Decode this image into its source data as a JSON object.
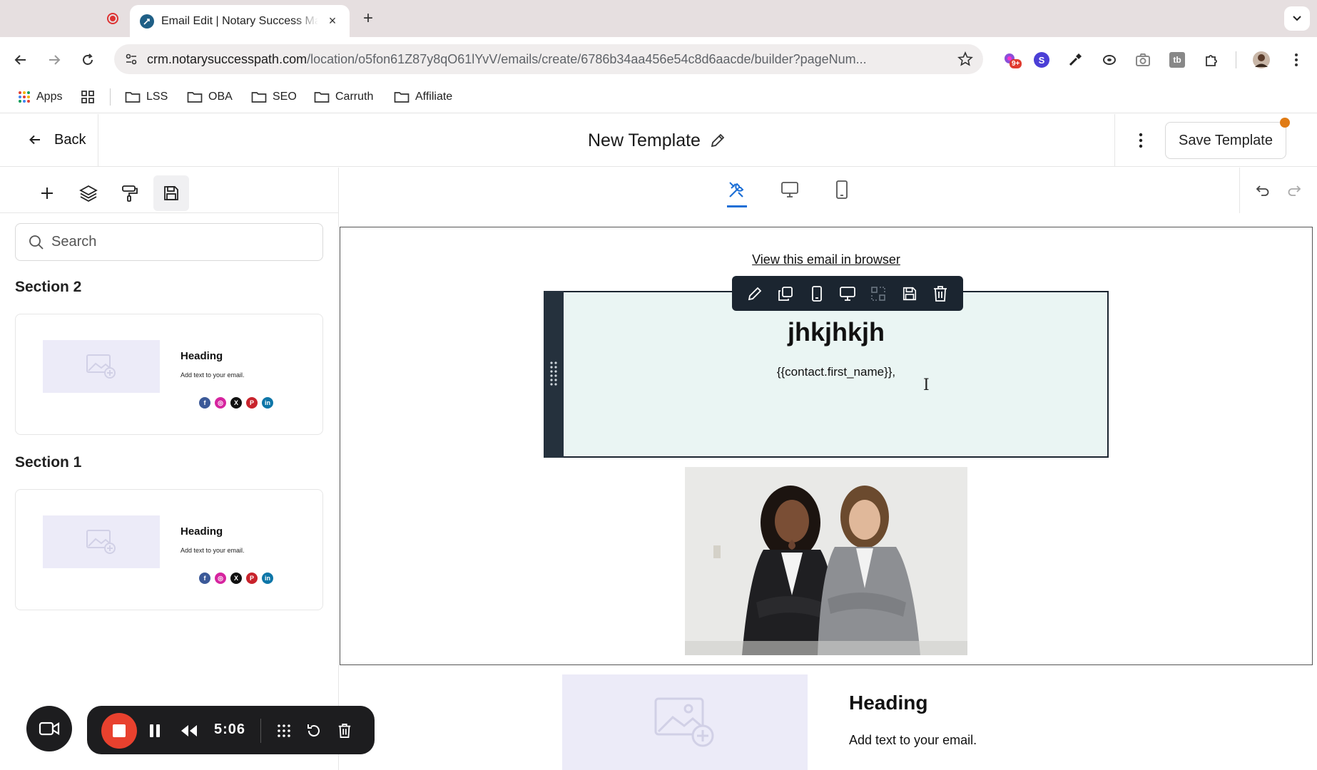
{
  "browser": {
    "tab_title": "Email Edit | Notary Success Mastery",
    "close_glyph": "×",
    "new_tab_glyph": "+",
    "url_host": "crm.notarysuccesspath.com",
    "url_path": "/location/o5fon61Z87y8qO61lYvV/emails/create/6786b34aa456e54c8d6aacde/builder?pageNum...",
    "extension_badge": "9+",
    "extension_s": "S",
    "extension_tb": "tb",
    "bookmarks": [
      {
        "label": "Apps"
      },
      {
        "label": "LSS"
      },
      {
        "label": "OBA"
      },
      {
        "label": "SEO"
      },
      {
        "label": "Carruth"
      },
      {
        "label": "Affiliate"
      }
    ]
  },
  "header": {
    "back_label": "Back",
    "title": "New Template",
    "save_label": "Save Template",
    "unsaved_dot_color": "#e07b14"
  },
  "left_panel": {
    "search_placeholder": "Search",
    "sections": [
      {
        "label": "Section 2",
        "heading": "Heading",
        "text": "Add text to your email."
      },
      {
        "label": "Section 1",
        "heading": "Heading",
        "text": "Add text to your email."
      }
    ],
    "social_letters": [
      "f",
      "◎",
      "X",
      "P",
      "in"
    ]
  },
  "canvas": {
    "view_in_browser": "View this email in browser",
    "selected_heading": "jhkjhkjh",
    "selected_merge_text": "{{contact.first_name}},",
    "text_cursor_glyph": "I",
    "below_heading": "Heading",
    "below_text": "Add text to your email."
  },
  "recorder": {
    "time": "5:06"
  },
  "colors": {
    "accent": "#1c6fd6",
    "section_bg": "#eaf5f3",
    "toolbar_dark": "#1b2530",
    "record_red": "#e8412e"
  }
}
